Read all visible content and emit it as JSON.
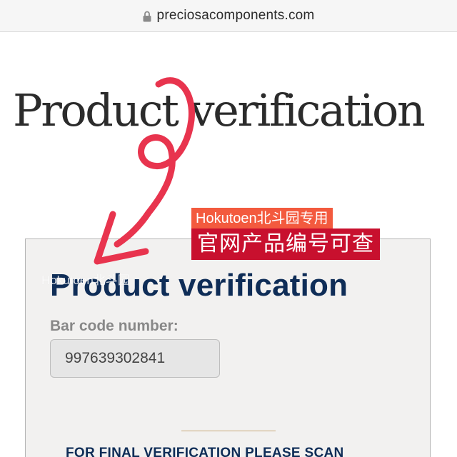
{
  "browser": {
    "url": "preciosacomponents.com"
  },
  "page": {
    "title": "Product verification"
  },
  "form": {
    "title": "Product verification",
    "barcode_label": "Bar code number:",
    "barcode_value": "997639302841",
    "scan_instruction": "FOR FINAL VERIFICATION PLEASE SCAN"
  },
  "overlay": {
    "watermark": "Hokutoen北斗园",
    "sticker_small": "Hokutoen北斗园专用",
    "sticker_large": "官网产品编号可查"
  },
  "colors": {
    "scribble": "#e8344e",
    "title_navy": "#0f2d57",
    "sticker_orange": "#f35a3e",
    "sticker_red": "#c8102e",
    "divider_gold": "#c9a97a"
  },
  "icons": {
    "lock": "lock-icon",
    "scribble": "scribble-arrow-annotation"
  }
}
